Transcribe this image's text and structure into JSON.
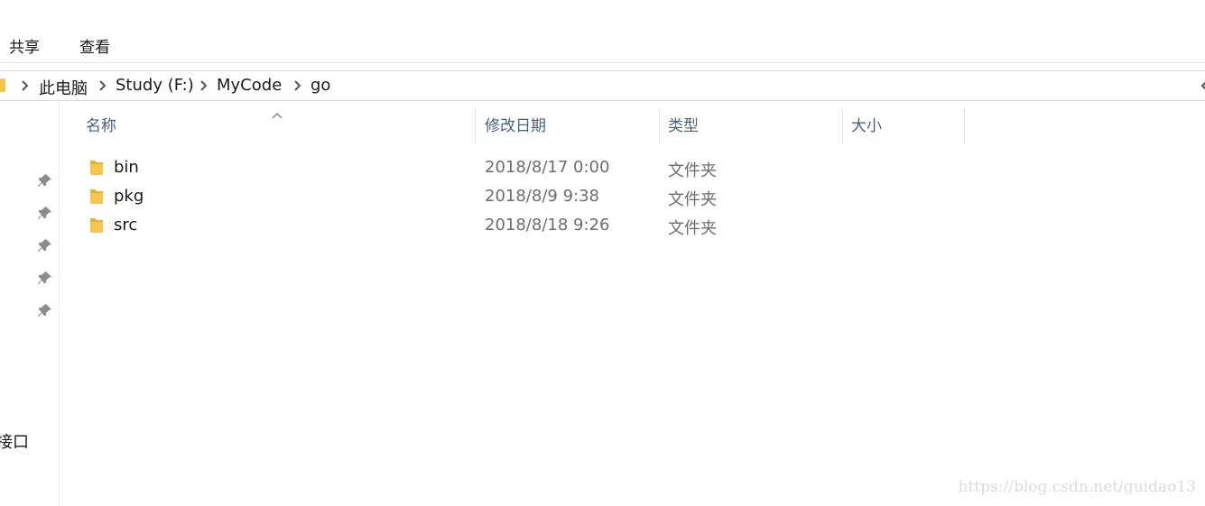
{
  "ribbon": {
    "tabs": [
      {
        "label": "共享"
      },
      {
        "label": "查看"
      }
    ]
  },
  "address": {
    "crumbs": [
      "此电脑",
      "Study (F:)",
      "MyCode",
      "go"
    ]
  },
  "nav": {
    "partial_label": "接口"
  },
  "columns": {
    "name": "名称",
    "date": "修改日期",
    "type": "类型",
    "size": "大小"
  },
  "files": [
    {
      "name": "bin",
      "date": "2018/8/17 0:00",
      "type": "文件夹"
    },
    {
      "name": "pkg",
      "date": "2018/8/9 9:38",
      "type": "文件夹"
    },
    {
      "name": "src",
      "date": "2018/8/18 9:26",
      "type": "文件夹"
    }
  ],
  "watermark": "https://blog.csdn.net/guidao13",
  "colors": {
    "folder": "#f4c64e",
    "folder_dark": "#e3b237",
    "header_text": "#4c607a",
    "detail_text": "#6d6d6d"
  }
}
